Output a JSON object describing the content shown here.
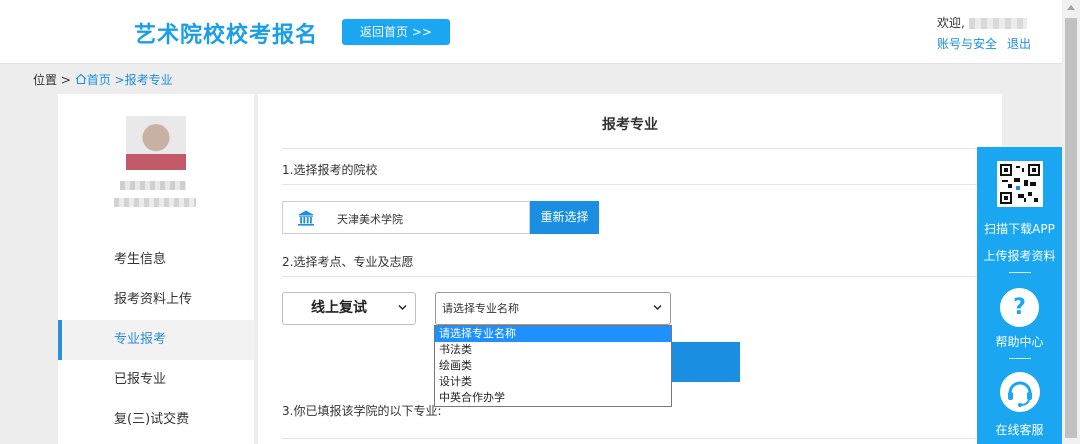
{
  "header": {
    "brand": "艺术院校校考报名",
    "home_button": "返回首页 >>",
    "welcome": "欢迎,",
    "account_link": "账号与安全",
    "logout_link": "退出"
  },
  "breadcrumb": {
    "prefix": "位置 >",
    "home": "首页",
    "current": ">报考专业"
  },
  "sidebar": {
    "menu": [
      {
        "label": "考生信息",
        "active": false
      },
      {
        "label": "报考资料上传",
        "active": false
      },
      {
        "label": "专业报考",
        "active": true
      },
      {
        "label": "已报专业",
        "active": false
      },
      {
        "label": "复(三)试交费",
        "active": false
      }
    ]
  },
  "main": {
    "title": "报考专业",
    "step1": "1.选择报考的院校",
    "school_name": "天津美术学院",
    "reselect_button": "重新选择",
    "step2": "2.选择考点、专业及志愿",
    "mode_select_value": "线上复试",
    "major_select_value": "请选择专业名称",
    "major_options": [
      "请选择专业名称",
      "书法类",
      "绘画类",
      "设计类",
      "中英合作办学"
    ],
    "step3": "3.你已填报该学院的以下专业:"
  },
  "side_panel": {
    "download_app": "扫描下载APP",
    "upload_materials": "上传报考资料",
    "help_center": "帮助中心",
    "online_service": "在线客服"
  },
  "colors": {
    "accent": "#1aa6f0",
    "link": "#1a8ee0",
    "selected_option": "#1e90ff"
  }
}
